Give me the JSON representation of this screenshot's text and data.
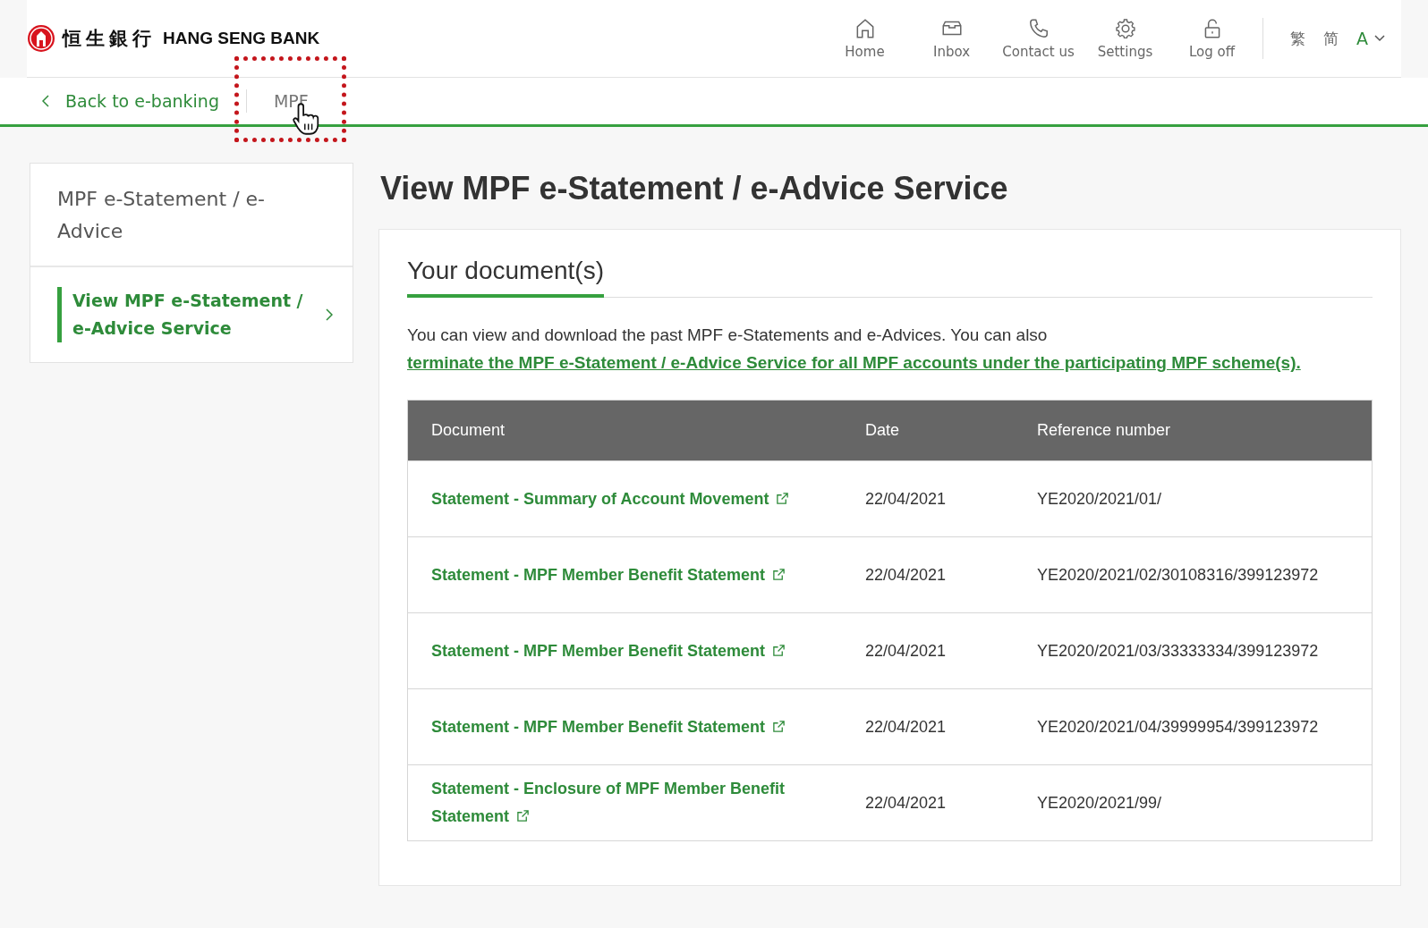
{
  "header": {
    "logo_chinese": "恒生銀行",
    "logo_text": "HANG SENG BANK",
    "nav": [
      {
        "kind": "home",
        "label": "Home"
      },
      {
        "kind": "inbox",
        "label": "Inbox"
      },
      {
        "kind": "phone",
        "label": "Contact us"
      },
      {
        "kind": "settings",
        "label": "Settings"
      },
      {
        "kind": "logoff",
        "label": "Log off"
      }
    ],
    "languages": [
      "繁",
      "简"
    ],
    "font_size": "A"
  },
  "subnav": {
    "back": "Back to e-banking",
    "current": {
      "label": "MPF",
      "highlighted": true
    }
  },
  "sidebar": {
    "heading": "MPF e-Statement / e-Advice",
    "items": [
      {
        "label": "View MPF e-Statement / e-Advice Service",
        "selected": true
      }
    ]
  },
  "main": {
    "title": "View MPF e-Statement / e-Advice Service",
    "tab": "Your document(s)",
    "intro": "You can view and download the past MPF e-Statements and e-Advices. You can also ",
    "intro_link": "terminate the MPF e-Statement / e-Advice Service for all MPF accounts under the participating MPF scheme(s).",
    "table": {
      "columns": [
        "Document",
        "Date",
        "Reference number"
      ],
      "rows": [
        {
          "document": "Statement - Summary of Account Movement",
          "date": "22/04/2021",
          "reference": "YE2020/2021/01/"
        },
        {
          "document": "Statement - MPF Member Benefit Statement",
          "date": "22/04/2021",
          "reference": "YE2020/2021/02/30108316/399123972"
        },
        {
          "document": "Statement - MPF Member Benefit Statement",
          "date": "22/04/2021",
          "reference": "YE2020/2021/03/33333334/399123972"
        },
        {
          "document": "Statement - MPF Member Benefit Statement",
          "date": "22/04/2021",
          "reference": "YE2020/2021/04/39999954/399123972"
        },
        {
          "document": "Statement - Enclosure of MPF Member Benefit Statement",
          "date": "22/04/2021",
          "reference": "YE2020/2021/99/"
        }
      ]
    }
  }
}
